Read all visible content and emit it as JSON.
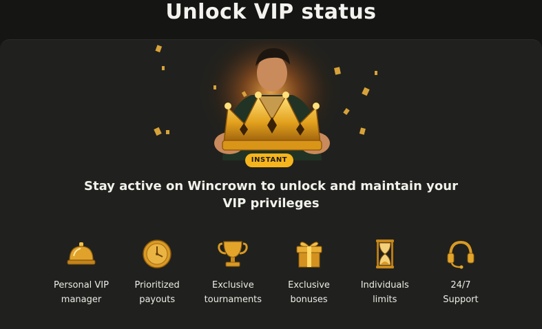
{
  "page": {
    "title": "Unlock VIP status"
  },
  "promo": {
    "badge": "INSTANT",
    "headline": "Stay active on Wincrown to unlock and maintain your VIP privileges"
  },
  "features": [
    {
      "icon": "service-bell-icon",
      "label": "Personal VIP\nmanager"
    },
    {
      "icon": "clock-icon",
      "label": "Prioritized\npayouts"
    },
    {
      "icon": "trophy-icon",
      "label": "Exclusive\ntournaments"
    },
    {
      "icon": "gift-box-icon",
      "label": "Exclusive\nbonuses"
    },
    {
      "icon": "hourglass-icon",
      "label": "Individuals\nlimits"
    },
    {
      "icon": "headset-icon",
      "label": "24/7\nSupport"
    }
  ],
  "colors": {
    "background": "#151614",
    "card": "#20211e",
    "badge": "#f6b51d",
    "gold": "#e0a22a"
  }
}
